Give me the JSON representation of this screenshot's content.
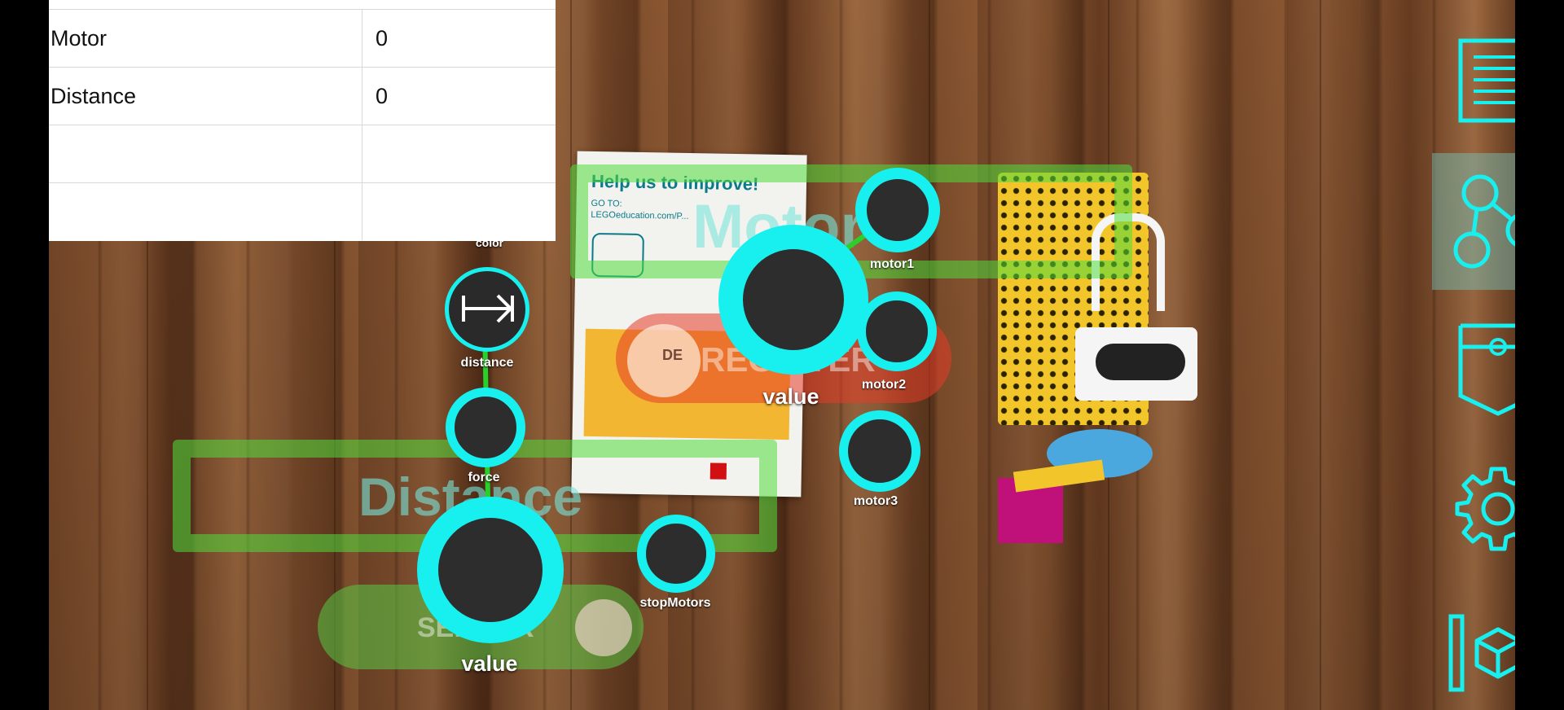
{
  "table": {
    "rows": [
      {
        "name": "Motor",
        "value": "0"
      },
      {
        "name": "Distance",
        "value": "0"
      },
      {
        "name": "",
        "value": ""
      },
      {
        "name": "",
        "value": ""
      }
    ]
  },
  "scene": {
    "ghost_labels": {
      "motor": "Motor",
      "distance": "Distance",
      "register": "REGISTER",
      "sensor": "SENSOR",
      "de": "DE"
    },
    "card": {
      "title": "Help us to improve!",
      "goto": "GO TO:",
      "url": "LEGOeducation.com/P..."
    }
  },
  "nodes": {
    "color": "color",
    "distance": "distance",
    "force": "force",
    "sensor_value": "value",
    "motor_value": "value",
    "motor1": "motor1",
    "motor2": "motor2",
    "motor3": "motor3",
    "stop_motors": "stopMotors"
  },
  "colors": {
    "accent": "#18f0f0",
    "connector": "#27d12a",
    "node_fill": "#2d2d2d"
  },
  "toolbar": {
    "items": [
      "list-icon",
      "graph-icon",
      "pocket-icon",
      "gear-icon",
      "cube-icon"
    ],
    "active": "graph-icon"
  }
}
